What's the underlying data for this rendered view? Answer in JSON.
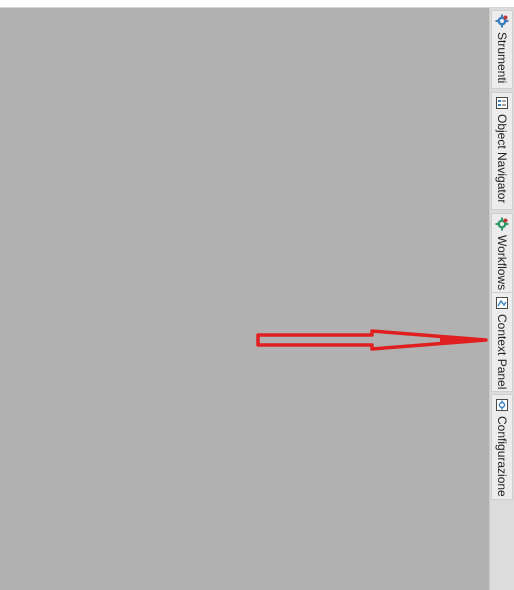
{
  "side_panel": {
    "tabs": [
      {
        "label": "Strumenti",
        "icon": "tools-icon"
      },
      {
        "label": "Object Navigator",
        "icon": "object-navigator-icon"
      },
      {
        "label": "Workflows",
        "icon": "workflows-icon"
      },
      {
        "label": "Context Panel",
        "icon": "context-panel-icon"
      },
      {
        "label": "Configurazione",
        "icon": "configuration-icon"
      }
    ]
  },
  "colors": {
    "workspace": "#b1b1b1",
    "dock": "#dcdcdc",
    "tab": "#ececec",
    "annotation_arrow": "#e02020"
  }
}
